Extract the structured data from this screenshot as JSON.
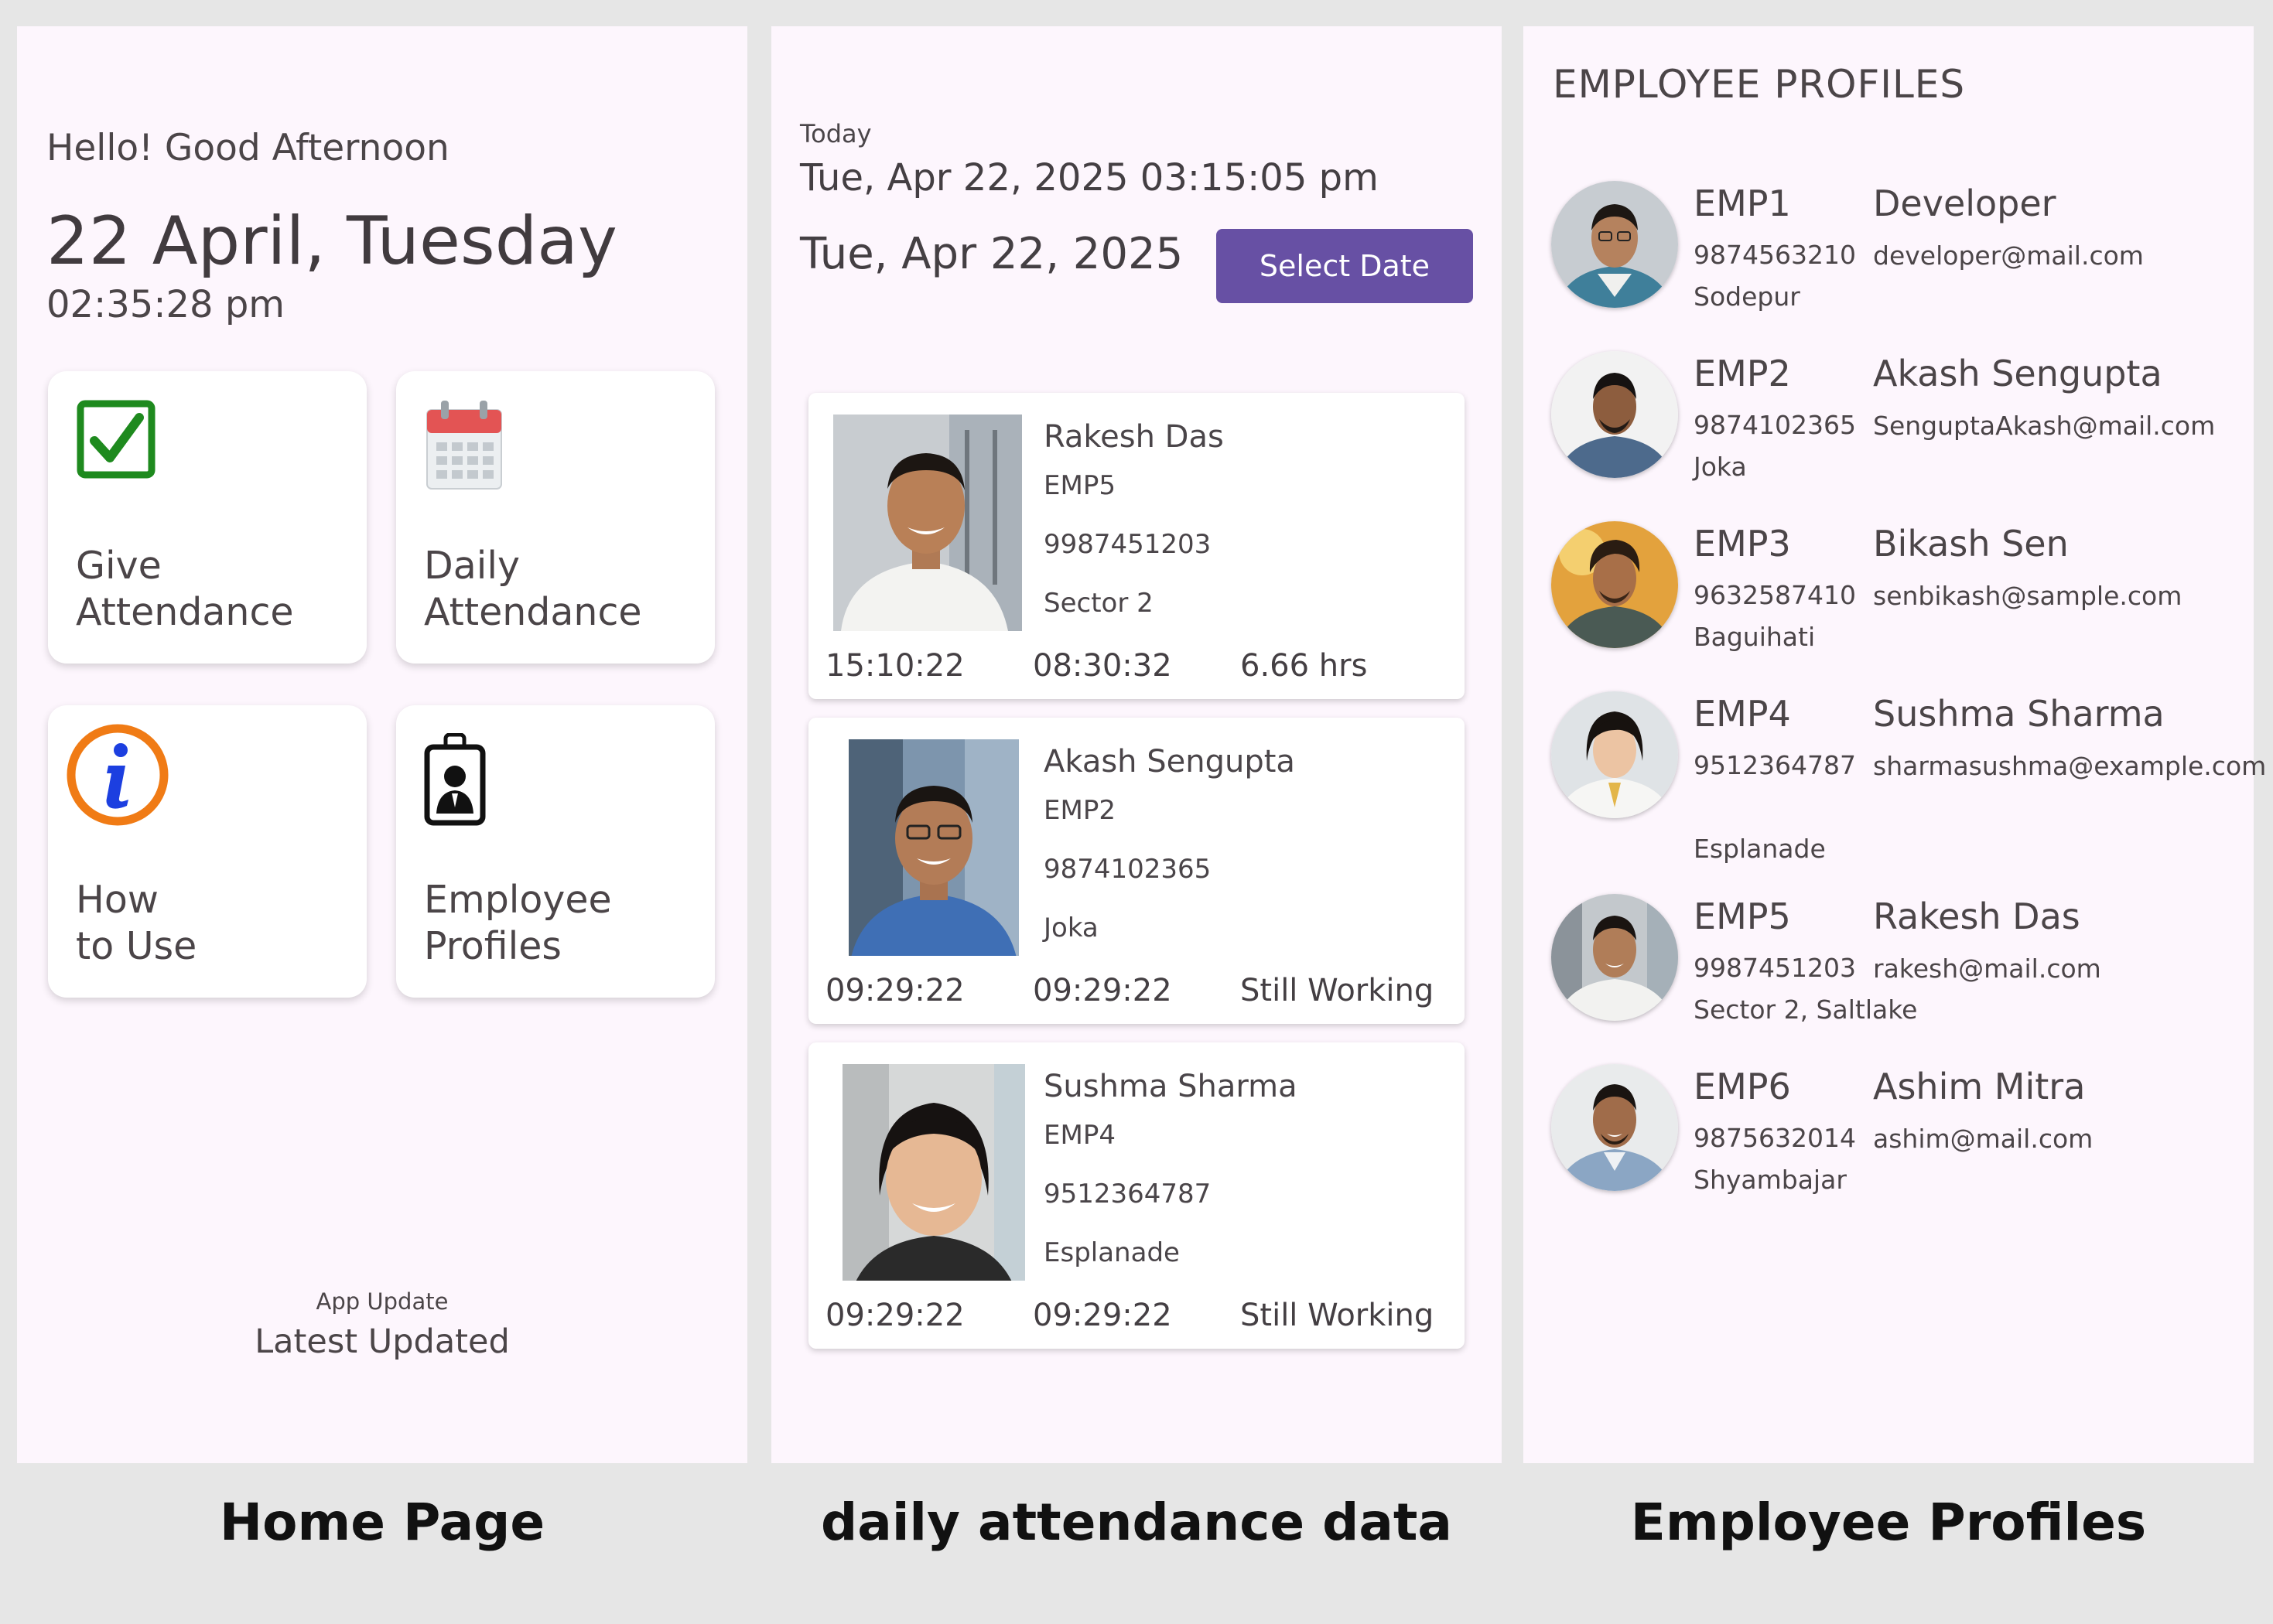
{
  "home": {
    "greeting": "Hello! Good Afternoon",
    "date": "22 April, Tuesday",
    "time": "02:35:28 pm",
    "tiles": [
      {
        "line1": "Give",
        "line2": "Attendance",
        "icon": "green-checkbox-icon"
      },
      {
        "line1": "Daily",
        "line2": "Attendance",
        "icon": "calendar-icon"
      },
      {
        "line1": "How",
        "line2": "to Use",
        "icon": "info-icon"
      },
      {
        "line1": "Employee",
        "line2": "Profiles",
        "icon": "id-badge-icon"
      }
    ],
    "update_label": "App Update",
    "update_status": "Latest Updated",
    "caption": "Home Page"
  },
  "attendance": {
    "today_label": "Today",
    "now": "Tue, Apr 22, 2025 03:15:05 pm",
    "selected_date": "Tue, Apr 22, 2025",
    "select_button": "Select Date",
    "records": [
      {
        "name": "Rakesh Das",
        "id": "EMP5",
        "phone": "9987451203",
        "address": "Sector 2",
        "in": "15:10:22",
        "out": "08:30:32",
        "status": "6.66 hrs"
      },
      {
        "name": "Akash Sengupta",
        "id": "EMP2",
        "phone": "9874102365",
        "address": "Joka",
        "in": "09:29:22",
        "out": "09:29:22",
        "status": "Still Working"
      },
      {
        "name": "Sushma Sharma",
        "id": "EMP4",
        "phone": "9512364787",
        "address": "Esplanade",
        "in": "09:29:22",
        "out": "09:29:22",
        "status": "Still Working"
      }
    ],
    "caption": "daily attendance data"
  },
  "profiles": {
    "title": "EMPLOYEE PROFILES",
    "employees": [
      {
        "id": "EMP1",
        "name": "Developer",
        "phone": "9874563210",
        "email": "developer@mail.com",
        "address": "Sodepur"
      },
      {
        "id": "EMP2",
        "name": "Akash Sengupta",
        "phone": "9874102365",
        "email": "SenguptaAkash@mail.com",
        "address": "Joka"
      },
      {
        "id": "EMP3",
        "name": "Bikash Sen",
        "phone": "9632587410",
        "email": "senbikash@sample.com",
        "address": "Baguihati"
      },
      {
        "id": "EMP4",
        "name": "Sushma Sharma",
        "phone": "9512364787",
        "email": "sharmasushma@example.com",
        "address": "Esplanade"
      },
      {
        "id": "EMP5",
        "name": "Rakesh Das",
        "phone": "9987451203",
        "email": "rakesh@mail.com",
        "address": "Sector 2, Saltlake"
      },
      {
        "id": "EMP6",
        "name": "Ashim Mitra",
        "phone": "9875632014",
        "email": "ashim@mail.com",
        "address": "Shyambajar"
      }
    ],
    "caption": "Employee Profiles"
  },
  "colors": {
    "accent": "#6750a4",
    "panel_bg": "#fdf6fd",
    "check_green": "#1e8a1e",
    "info_orange": "#f07b15",
    "info_blue": "#1c3fe0",
    "calendar_red": "#e35454"
  }
}
